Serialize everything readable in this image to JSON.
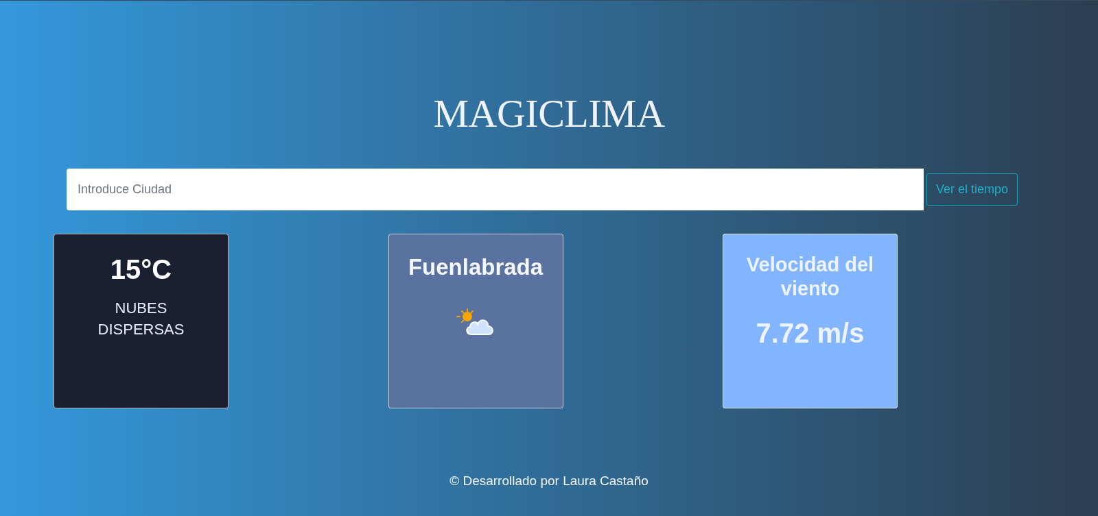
{
  "title": "MAGICLIMA",
  "search": {
    "placeholder": "Introduce Ciudad",
    "button": "Ver el tiempo"
  },
  "cards": [
    {
      "kind": "temperature",
      "value": "15°C",
      "description": "NUBES DISPERSAS"
    },
    {
      "kind": "location",
      "city": "Fuenlabrada"
    },
    {
      "kind": "wind",
      "label": "Velocidad del viento",
      "value": "7.72 m/s"
    }
  ],
  "footer": "© Desarrollado por Laura Castaño"
}
